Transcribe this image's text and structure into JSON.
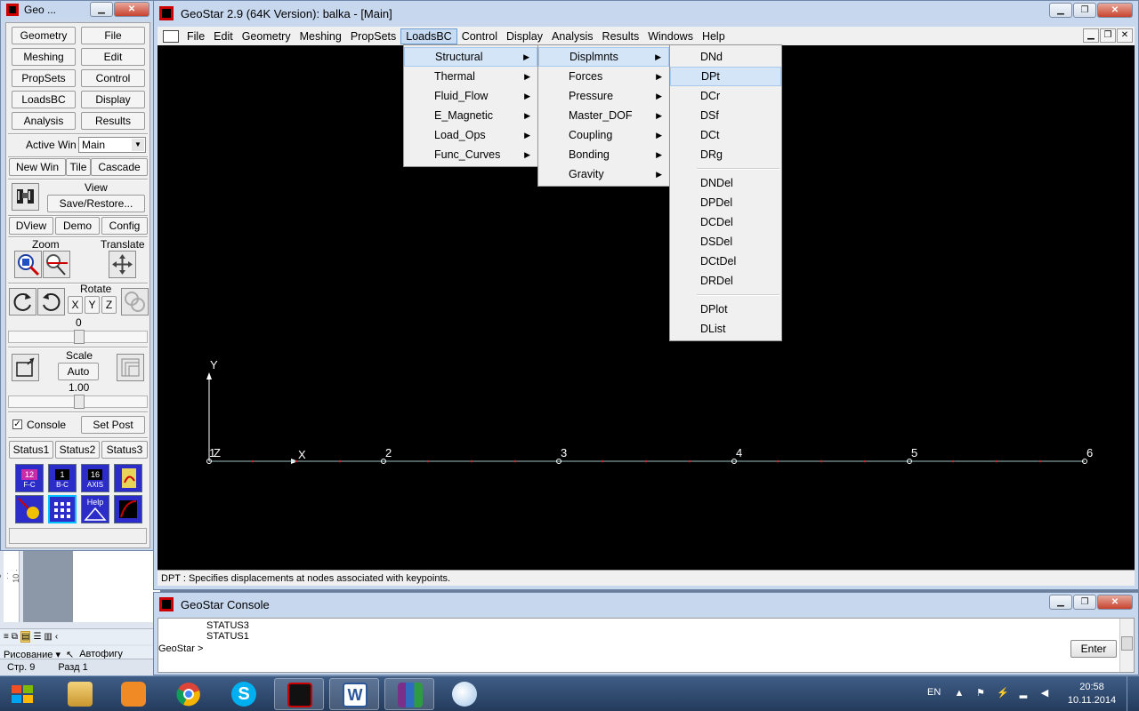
{
  "toolbar_window": {
    "title": "Geo ...",
    "buttons_top": [
      "Geometry",
      "File",
      "Meshing",
      "Edit",
      "PropSets",
      "Control",
      "LoadsBC",
      "Display",
      "Analysis",
      "Results"
    ],
    "active_win_label": "Active Win",
    "active_win_value": "Main",
    "win_buttons": [
      "New Win",
      "Tile",
      "Cascade"
    ],
    "view_label": "View",
    "save_restore": "Save/Restore...",
    "mid_buttons": [
      "DView",
      "Demo",
      "Config"
    ],
    "zoom_label": "Zoom",
    "translate_label": "Translate",
    "rotate_label": "Rotate",
    "axis_buttons": [
      "X",
      "Y",
      "Z"
    ],
    "rotate_value": "0",
    "scale_label": "Scale",
    "scale_auto": "Auto",
    "scale_value": "1.00",
    "console_label": "Console",
    "console_checked": true,
    "set_post": "Set Post",
    "status_buttons": [
      "Status1",
      "Status2",
      "Status3"
    ],
    "tool_icons": [
      "12 F-C",
      "1 B-C",
      "16 AXIS",
      "hand",
      "fff",
      "Help"
    ]
  },
  "main_window": {
    "title": "GeoStar 2.9 (64K Version): balka - [Main]",
    "menu": [
      "File",
      "Edit",
      "Geometry",
      "Meshing",
      "PropSets",
      "LoadsBC",
      "Control",
      "Display",
      "Analysis",
      "Results",
      "Windows",
      "Help"
    ],
    "active_menu": "LoadsBC",
    "status_text": "DPT : Specifies displacements at nodes associated with keypoints."
  },
  "menus": {
    "loadsbc": [
      "Structural",
      "Thermal",
      "Fluid_Flow",
      "E_Magnetic",
      "Load_Ops",
      "Func_Curves"
    ],
    "structural": [
      "Displmnts",
      "Forces",
      "Pressure",
      "Master_DOF",
      "Coupling",
      "Bonding",
      "Gravity"
    ],
    "displmnts_group1": [
      "DNd",
      "DPt",
      "DCr",
      "DSf",
      "DCt",
      "DRg"
    ],
    "displmnts_group2": [
      "DNDel",
      "DPDel",
      "DCDel",
      "DSDel",
      "DCtDel",
      "DRDel"
    ],
    "displmnts_group3": [
      "DPlot",
      "DList"
    ],
    "highlighted": "DPt"
  },
  "canvas": {
    "axis_y": "Y",
    "axis_x": "X",
    "keypoints": [
      "1",
      "2",
      "3",
      "4",
      "5",
      "6"
    ],
    "keypoint_extra": "Z"
  },
  "console": {
    "title": "GeoStar Console",
    "lines": [
      "STATUS3",
      "STATUS1"
    ],
    "prompt": "GeoStar >",
    "enter": "Enter"
  },
  "background_app": {
    "ruler": "· 9 · · · 10 · ·",
    "draw_menu": "Рисование ▾",
    "autoshapes": "Автофигу",
    "page": "Стр. 9",
    "section": "Разд 1"
  },
  "taskbar": {
    "lang": "EN",
    "time": "20:58",
    "date": "10.11.2014"
  }
}
